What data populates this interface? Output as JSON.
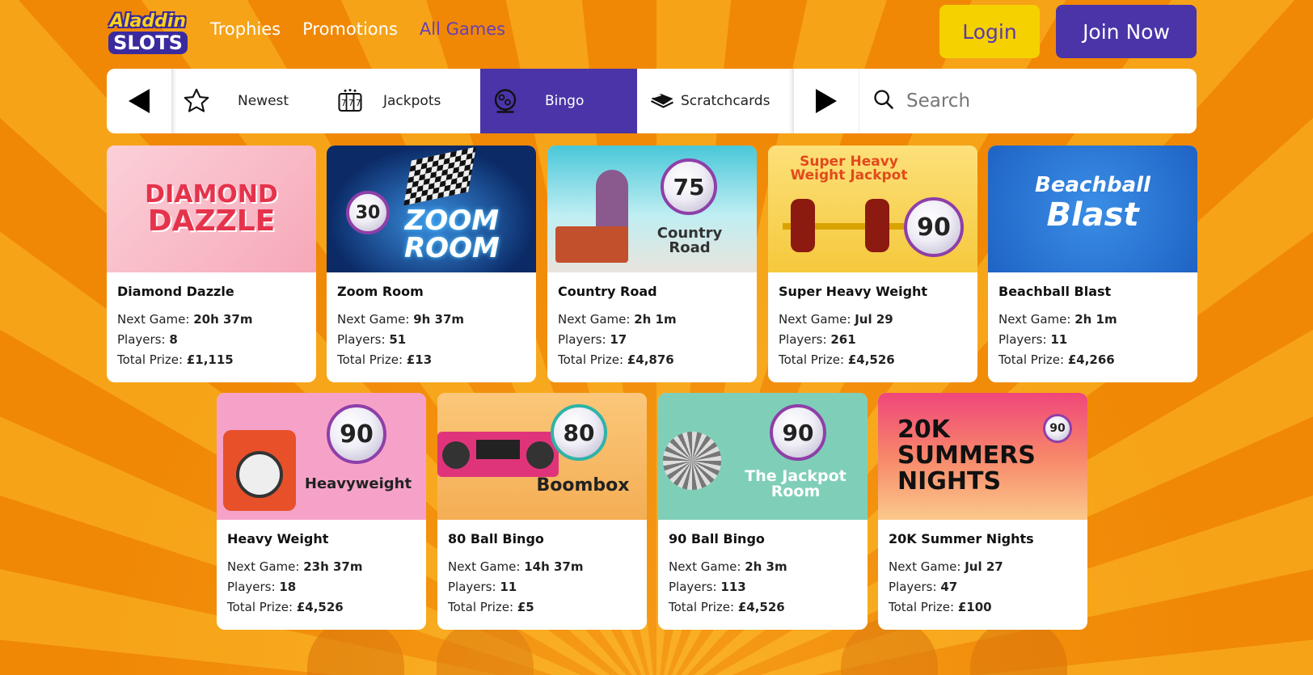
{
  "brand": {
    "logo_line1": "Aladdin",
    "logo_line2": "SLOTS"
  },
  "nav": {
    "items": [
      "Trophies",
      "Promotions",
      "All Games"
    ],
    "active": "All Games"
  },
  "auth": {
    "login": "Login",
    "join": "Join Now"
  },
  "categories": {
    "tabs": [
      {
        "label": "Newest",
        "icon": "star-icon"
      },
      {
        "label": "Jackpots",
        "icon": "slot-machine-icon"
      },
      {
        "label": "Bingo",
        "icon": "bingo-ball-icon",
        "active": true
      },
      {
        "label": "Scratchcards",
        "icon": "scratchcard-icon"
      }
    ],
    "search_placeholder": "Search"
  },
  "labels": {
    "next_game": "Next Game:",
    "players": "Players:",
    "total_prize": "Total Prize:"
  },
  "games": [
    {
      "name": "Diamond Dazzle",
      "next_game": "20h 37m",
      "players": "8",
      "total_prize": "£1,115",
      "art_text": [
        "DIAMOND",
        "DAZZLE"
      ]
    },
    {
      "name": "Zoom Room",
      "next_game": "9h 37m",
      "players": "51",
      "total_prize": "£13",
      "art_text": [
        "ZOOM",
        "ROOM"
      ],
      "ball": "30"
    },
    {
      "name": "Country Road",
      "next_game": "2h 1m",
      "players": "17",
      "total_prize": "£4,876",
      "art_text": [
        "Country",
        "Road"
      ],
      "ball": "75"
    },
    {
      "name": "Super Heavy Weight",
      "next_game": "Jul 29",
      "players": "261",
      "total_prize": "£4,526",
      "art_text": [
        "Super Heavy",
        "Weight Jackpot"
      ],
      "ball": "90"
    },
    {
      "name": "Beachball Blast",
      "next_game": "2h 1m",
      "players": "11",
      "total_prize": "£4,266",
      "art_text": [
        "Beachball",
        "Blast"
      ]
    },
    {
      "name": "Heavy Weight",
      "next_game": "23h 37m",
      "players": "18",
      "total_prize": "£4,526",
      "art_text": [
        "Heavyweight"
      ],
      "ball": "90"
    },
    {
      "name": "80 Ball Bingo",
      "next_game": "14h 37m",
      "players": "11",
      "total_prize": "£5",
      "art_text": [
        "Boombox"
      ],
      "ball": "80"
    },
    {
      "name": "90 Ball Bingo",
      "next_game": "2h 3m",
      "players": "113",
      "total_prize": "£4,526",
      "art_text": [
        "The Jackpot",
        "Room"
      ],
      "ball": "90"
    },
    {
      "name": "20K Summer Nights",
      "next_game": "Jul 27",
      "players": "47",
      "total_prize": "£100",
      "art_text": [
        "20K",
        "SUMMERS",
        "NIGHTS"
      ],
      "ball": "90"
    }
  ],
  "colors": {
    "brand_purple": "#4b34a8",
    "login_yellow": "#f5d100",
    "background_orange": "#f59a0c"
  }
}
